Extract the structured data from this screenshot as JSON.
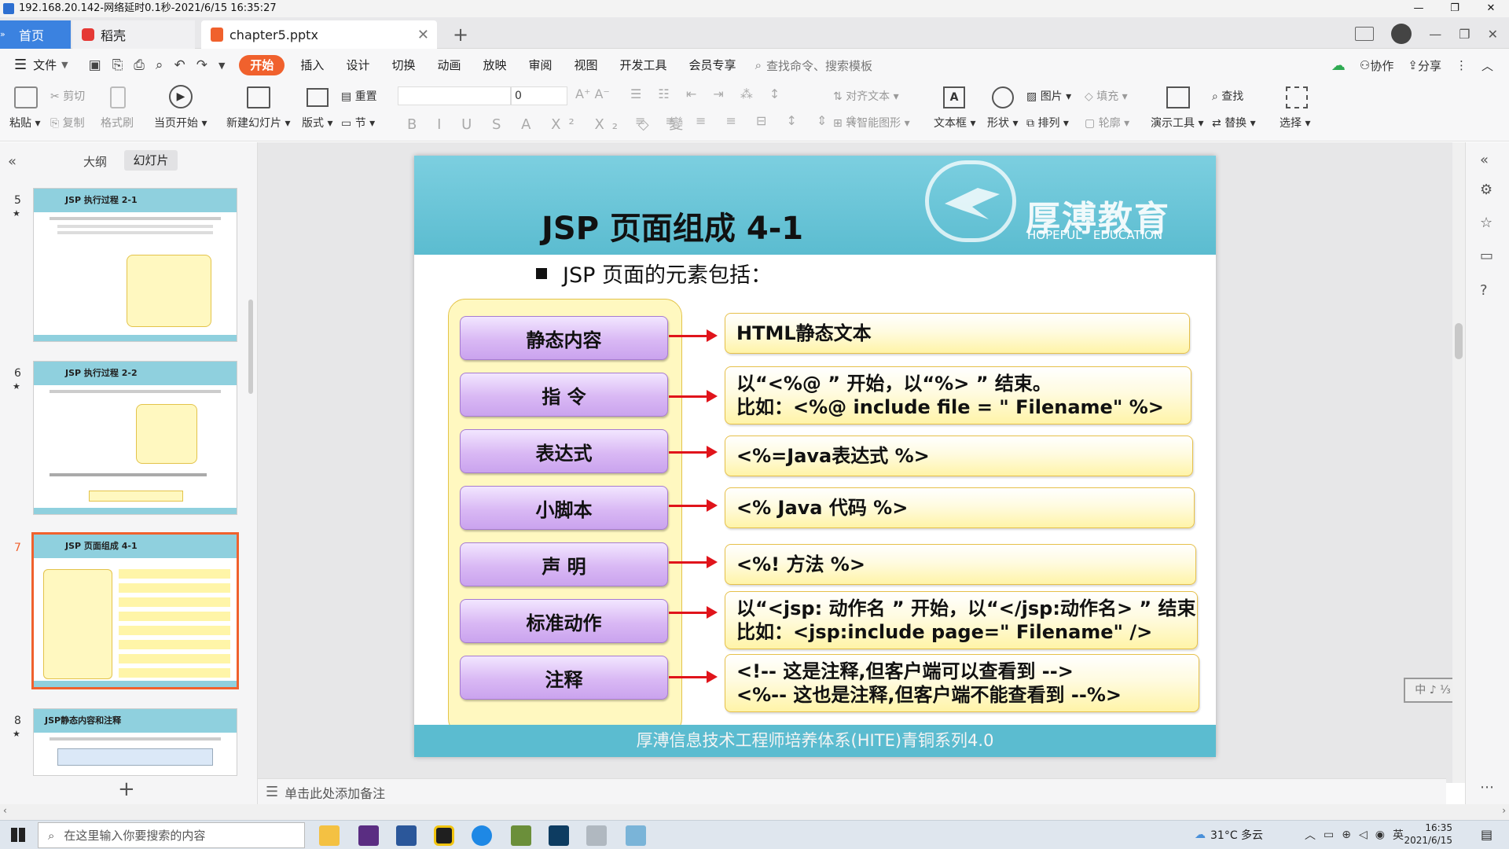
{
  "window": {
    "title": "192.168.20.142-网络延时0.1秒-2021/6/15 16:35:27"
  },
  "tabs": [
    {
      "label": "首页"
    },
    {
      "label": "稻壳"
    },
    {
      "label": "chapter5.pptx"
    }
  ],
  "menu": {
    "file": "文件",
    "items": [
      "开始",
      "插入",
      "设计",
      "切换",
      "动画",
      "放映",
      "审阅",
      "视图",
      "开发工具",
      "会员专享"
    ],
    "search_placeholder": "查找命令、搜索模板",
    "collab": "协作",
    "share": "分享"
  },
  "ribbon": {
    "paste": "粘贴",
    "cut": "剪切",
    "copy": "复制",
    "format_painter": "格式刷",
    "from_current": "当页开始",
    "new_slide": "新建幻灯片",
    "layout": "版式",
    "reset": "重置",
    "section": "节",
    "font_size": "0",
    "align_text": "对齐文本",
    "smart_art": "转智能图形",
    "textbox": "文本框",
    "shape": "形状",
    "picture": "图片",
    "arrange": "排列",
    "fill": "填充",
    "outline": "轮廓",
    "present_tool": "演示工具",
    "find": "查找",
    "replace": "替换",
    "select": "选择"
  },
  "leftpanel": {
    "tab_outline": "大纲",
    "tab_slides": "幻灯片",
    "thumbs": [
      {
        "num": "5",
        "title": "JSP 执行过程 2-1"
      },
      {
        "num": "6",
        "title": "JSP 执行过程 2-2"
      },
      {
        "num": "7",
        "title": "JSP 页面组成 4-1"
      },
      {
        "num": "8",
        "title": "JSP静态内容和注释"
      }
    ]
  },
  "slide": {
    "title": "JSP 页面组成 4-1",
    "logo_cn": "厚溥教育",
    "logo_en": "HOPEFUL   EDUCATION",
    "bullet": "JSP 页面的元素包括：",
    "rows": [
      {
        "left": "静态内容",
        "right1": "HTML静态文本",
        "right2": ""
      },
      {
        "left": "指 令",
        "right1": "以“<%@ ” 开始，以“%> ” 结束。",
        "right2": "比如：<%@ include file = \" Filename\" %>"
      },
      {
        "left": "表达式",
        "right1": "<%=Java表达式 %>",
        "right2": ""
      },
      {
        "left": "小脚本",
        "right1": "<% Java 代码 %>",
        "right2": ""
      },
      {
        "left": "声 明",
        "right1": "<%! 方法 %>",
        "right2": ""
      },
      {
        "left": "标准动作",
        "right1": "以“<jsp: 动作名 ”  开始，以“</jsp:动作名> ” 结束",
        "right2": "比如：<jsp:include page=\" Filename\" />"
      },
      {
        "left": "注释",
        "right1": "<!-- 这是注释,但客户端可以查看到 -->",
        "right2": "<%-- 这也是注释,但客户端不能查看到 --%>"
      }
    ],
    "footer": "厚溥信息技术工程师培养体系(HITE)青铜系列4.0"
  },
  "notes": {
    "placeholder": "单击此处添加备注"
  },
  "ime": {
    "label": "中 ♪ ⅓"
  },
  "taskbar": {
    "search_placeholder": "在这里输入你要搜索的内容",
    "weather": "31°C 多云",
    "lang": "英",
    "time": "16:35",
    "date": "2021/6/15"
  },
  "colors": {
    "accent_orange": "#f0612d",
    "slide_teal": "#5bbcd0",
    "title_blue": "#1d4f8b"
  }
}
